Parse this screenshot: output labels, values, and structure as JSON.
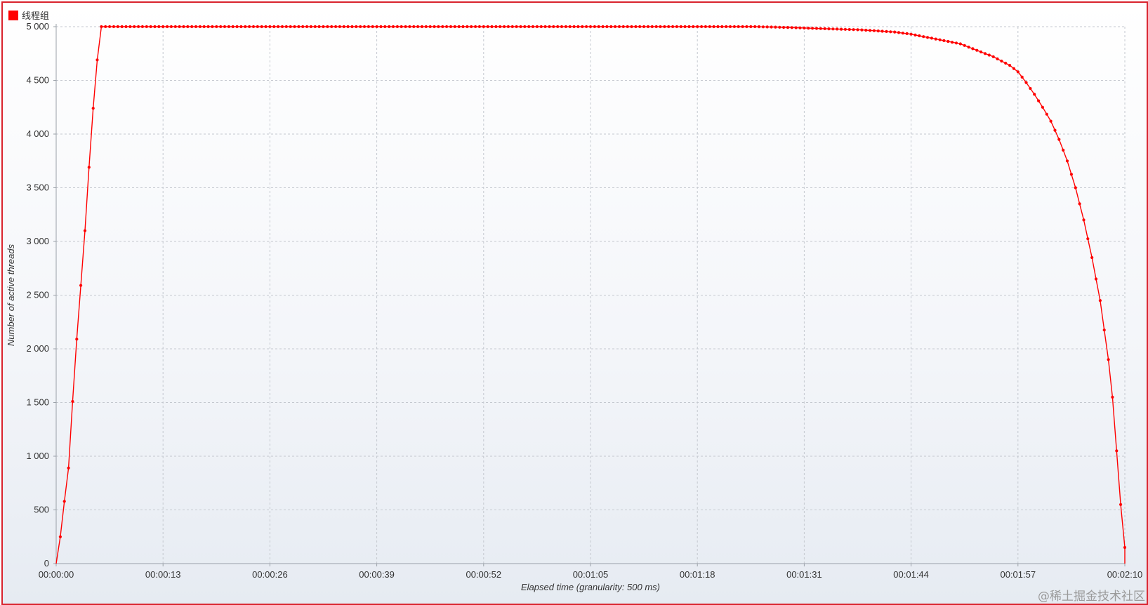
{
  "chart_data": {
    "type": "line",
    "legend": {
      "label": "线程组",
      "position": "top-left"
    },
    "xlabel": "Elapsed time (granularity: 500 ms)",
    "ylabel": "Number of active threads",
    "x_unit": "seconds",
    "xlim": [
      0,
      130
    ],
    "ylim": [
      0,
      5000
    ],
    "x_tick_labels": [
      "00:00:00",
      "00:00:13",
      "00:00:26",
      "00:00:39",
      "00:00:52",
      "00:01:05",
      "00:01:18",
      "00:01:31",
      "00:01:44",
      "00:01:57",
      "00:02:10"
    ],
    "x_tick_values": [
      0,
      13,
      26,
      39,
      52,
      65,
      78,
      91,
      104,
      117,
      130
    ],
    "y_tick_labels": [
      "0",
      "500",
      "1 000",
      "1 500",
      "2 000",
      "2 500",
      "3 000",
      "3 500",
      "4 000",
      "4 500",
      "5 000"
    ],
    "y_tick_values": [
      0,
      500,
      1000,
      1500,
      2000,
      2500,
      3000,
      3500,
      4000,
      4500,
      5000
    ],
    "grid": true,
    "series": [
      {
        "name": "线程组",
        "color": "#ff0000",
        "keypoints": [
          [
            0,
            0
          ],
          [
            0.5,
            250
          ],
          [
            1,
            580
          ],
          [
            1.5,
            890
          ],
          [
            2,
            1510
          ],
          [
            2.5,
            2090
          ],
          [
            3,
            2590
          ],
          [
            3.5,
            3100
          ],
          [
            4,
            3690
          ],
          [
            4.5,
            4240
          ],
          [
            5,
            4690
          ],
          [
            5.5,
            5000
          ],
          [
            85,
            5000
          ],
          [
            88,
            4995
          ],
          [
            90,
            4990
          ],
          [
            92,
            4985
          ],
          [
            94,
            4980
          ],
          [
            96,
            4975
          ],
          [
            98,
            4970
          ],
          [
            100,
            4960
          ],
          [
            102,
            4950
          ],
          [
            104,
            4930
          ],
          [
            106,
            4900
          ],
          [
            108,
            4870
          ],
          [
            110,
            4840
          ],
          [
            112,
            4780
          ],
          [
            114,
            4720
          ],
          [
            116,
            4640
          ],
          [
            117,
            4580
          ],
          [
            118,
            4480
          ],
          [
            119,
            4370
          ],
          [
            120,
            4250
          ],
          [
            121,
            4120
          ],
          [
            122,
            3950
          ],
          [
            123,
            3750
          ],
          [
            124,
            3500
          ],
          [
            125,
            3200
          ],
          [
            126,
            2850
          ],
          [
            127,
            2450
          ],
          [
            128,
            1900
          ],
          [
            128.5,
            1550
          ],
          [
            129,
            1050
          ],
          [
            129.5,
            550
          ],
          [
            130,
            150
          ],
          [
            130,
            0
          ]
        ]
      }
    ]
  },
  "watermark": "@稀土掘金技术社区"
}
